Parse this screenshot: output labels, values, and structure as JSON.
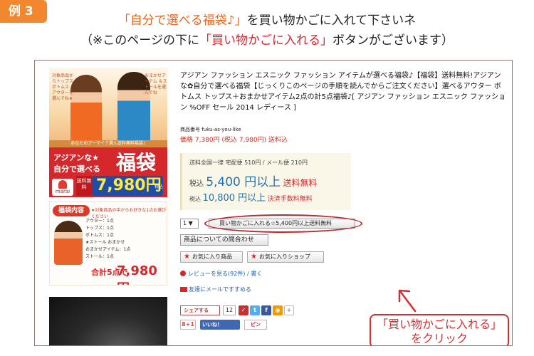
{
  "header": {
    "badge": "例 3",
    "line1_quote": "「自分で選べる福袋♪」",
    "line1_rest": "を買い物かごに入れて下さいネ",
    "line2_start": "（※このページの下に",
    "line2_quote": "「買い物かごに入れる」",
    "line2_end": "ボタンがございます）"
  },
  "product": {
    "title": "アジアン ファッション エスニック ファッション アイテムが選べる福袋♪【福袋】送料無料!アジアンな✿自分で選べる福袋【じっくりこのページの手順を読んでからご注文ください】選べるアウター ボトムス トップス＋おまかせアイテム2点の計5点福袋♪[ アジアン ファッション エスニック ファッション %OFF セール 2014 レディース ]",
    "sku": "商品番号 fuku-as-you-like",
    "price": "価格 7,380円 (税込 7,980円) 送料込",
    "shipping_line1": "送料全国一律 宅配便 510円 / メール便 210円",
    "ship_tax1": "税込",
    "ship_amount1": "5,400 円以上",
    "ship_note1": "送料無料",
    "ship_tax2": "税込",
    "ship_amount2": "10,800 円以上",
    "ship_note2": "決済手数料無料",
    "qty": "1 ▼",
    "cart_button": "買い物かごに入れる☆5,400円以上送料無料",
    "inquiry_button": "商品についての問合わせ",
    "fav_item": "お気に入り商品",
    "fav_shop": "お気に入りショップ",
    "review_link": "レビューを見る(92件) / 書く",
    "mail_link": "友達にメールですすめる",
    "share_label": "シェアする",
    "share_count": "12",
    "like_label": "いいね！",
    "pin_label": "ピン",
    "gplus": "8+1"
  },
  "banner": {
    "strip": "あなたのアーマイク選ん送料無料福袋♪",
    "note_left": "対象商品からトップス ボトムス アウターを選んでね★",
    "note_right": "おまかせアイテム ＆ストールを選んでね",
    "line1": "アジアンな★",
    "line2": "自分で選べる",
    "big": "福袋",
    "tag": "送料無料",
    "price": "7,980円",
    "logo": "marai",
    "rs": "税込"
  },
  "contents": {
    "title": "福袋内容",
    "sub": "★対象商品の中からお好きな1点お選びください",
    "rows": [
      "アウター：1点",
      "トップス：1点",
      "ボトムス：1点",
      "★ストール おまかせ",
      "おまかせアイテム：1点",
      "ストール：1点"
    ],
    "total_label": "合計5点で",
    "total_price": "7,980円"
  },
  "callout": {
    "line1": "「買い物かごに入れる」",
    "line2": "をクリック"
  },
  "colors": {
    "accent_orange": "#f2872d",
    "accent_red": "#d9262b",
    "link_blue": "#1c5fae"
  }
}
